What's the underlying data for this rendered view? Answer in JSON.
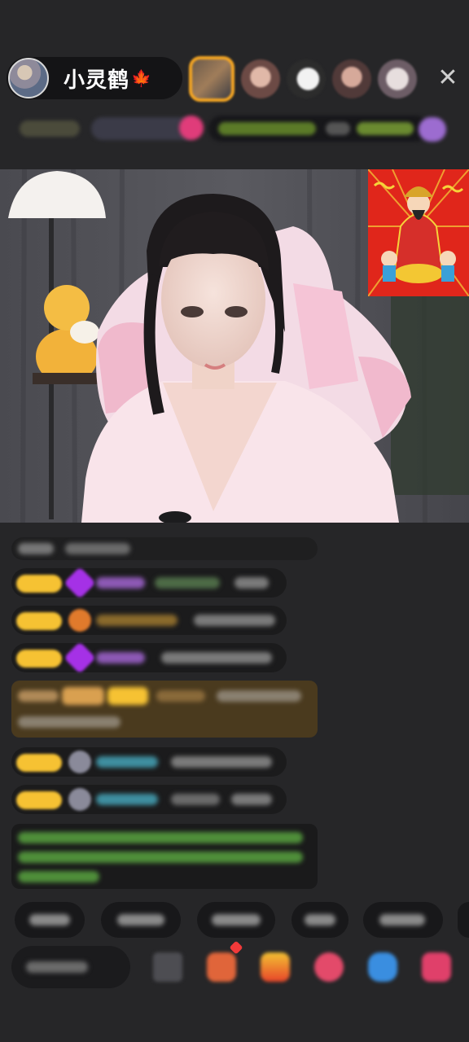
{
  "header": {
    "streamer_name": "小灵鹤",
    "name_emoji": "🍁"
  },
  "icons": {
    "avatar": "streamer-avatar",
    "close": "close-icon",
    "mascot": "god-of-wealth-sticker"
  },
  "glyphs": {
    "close": "✕"
  },
  "colors": {
    "background": "#262628",
    "gold_badge": "#f6c233",
    "purple_gem": "#a531e6",
    "gift_highlight": "#6a4a16",
    "green_notice": "#1f4d22",
    "red_dot": "#f23a3a"
  }
}
